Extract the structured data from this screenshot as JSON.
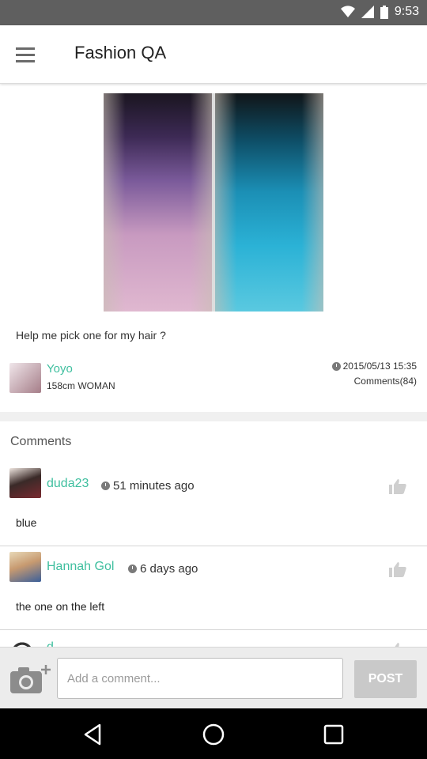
{
  "status_bar": {
    "time": "9:53"
  },
  "app_bar": {
    "title": "Fashion QA"
  },
  "post": {
    "question": "Help me pick one for my hair ?",
    "author": {
      "name": "Yoyo",
      "info": "158cm  WOMAN"
    },
    "date": "2015/05/13 15:35",
    "comments_count": "Comments(84)"
  },
  "comments_section": {
    "title": "Comments",
    "items": [
      {
        "name": "duda23",
        "time": "51 minutes ago",
        "text": "blue"
      },
      {
        "name": "Hannah Gol",
        "time": "6 days ago",
        "text": "the one on the left"
      },
      {
        "name": "d",
        "time": "",
        "text": ""
      }
    ]
  },
  "input_bar": {
    "placeholder": "Add a comment...",
    "post_label": "POST"
  },
  "icons": {
    "menu": "hamburger-menu-icon",
    "clock": "clock-icon",
    "like": "thumbs-up-icon",
    "camera": "camera-add-icon",
    "nav_back": "triangle-back-icon",
    "nav_home": "circle-home-icon",
    "nav_recent": "square-recent-icon"
  },
  "colors": {
    "accent": "#3fbf9f",
    "status_bar": "#5f5f5f",
    "nav_bar": "#000000"
  }
}
